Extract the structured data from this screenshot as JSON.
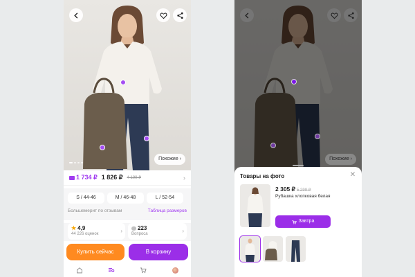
{
  "product": {
    "card_price": "1 734 ₽",
    "price": "1 826 ₽",
    "old_price": "4 199 ₽",
    "sizes": [
      "S / 44-46",
      "M / 46-48",
      "L / 52-54"
    ],
    "size_note": "Большемерит по отзывам",
    "size_table": "Таблица размеров",
    "rating": "4,9",
    "rating_count": "44 226 оценок",
    "questions_count": "223",
    "questions_label": "Вопроса",
    "buy_now": "Купить сейчас",
    "to_cart": "В корзину",
    "similar": "Похожие"
  },
  "sheet": {
    "title": "Товары на фото",
    "item": {
      "price": "2 305 ₽",
      "old_price": "5 299 ₽",
      "name": "Рубашка хлопковая белая",
      "delivery": "Завтра"
    }
  },
  "colors": {
    "accent": "#9b2ee8",
    "buy_now": "#ff8a20"
  },
  "icons": [
    "back-icon",
    "heart-icon",
    "share-icon",
    "home-icon",
    "catalog-icon",
    "cart-icon",
    "profile-avatar",
    "close-icon",
    "chevron-right-icon",
    "star-icon",
    "chat-bubble-icon",
    "cart-small-icon"
  ]
}
